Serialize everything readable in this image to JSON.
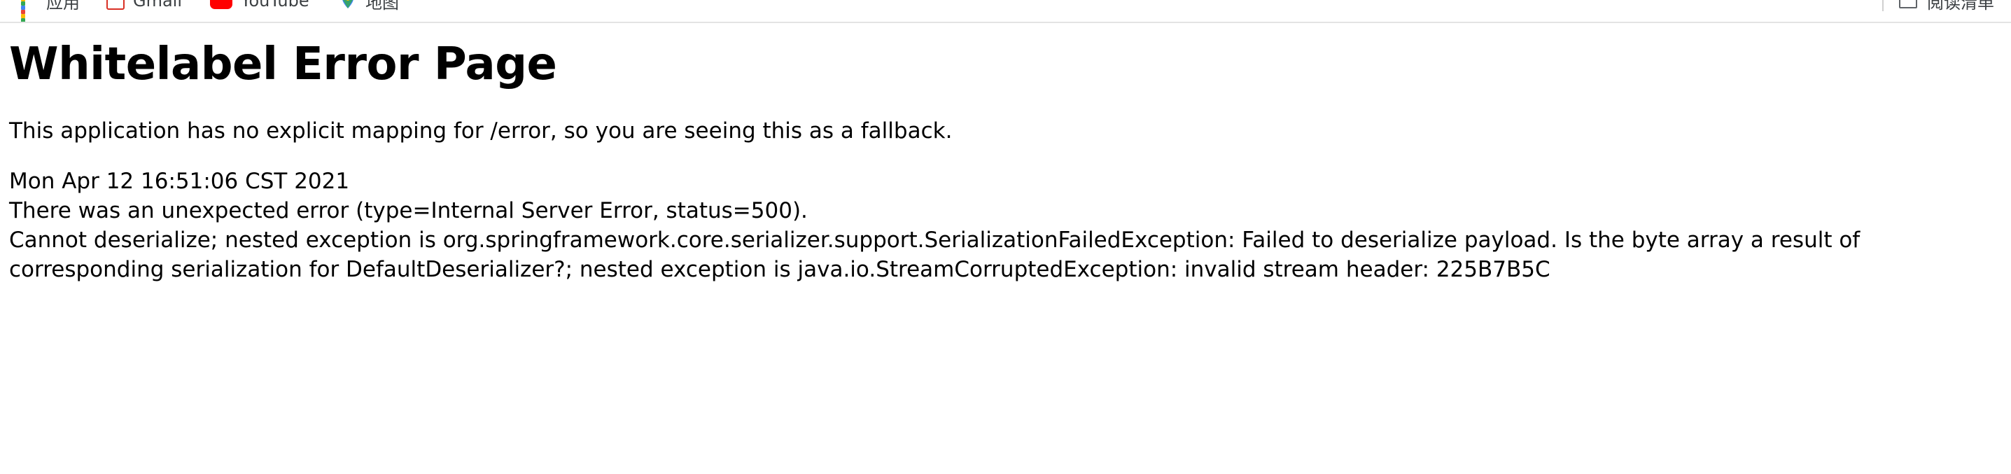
{
  "browser": {
    "bookmarks": [
      {
        "label": "应用",
        "icon": "apps-grid-icon"
      },
      {
        "label": "Gmail",
        "icon": "gmail-icon"
      },
      {
        "label": "YouTube",
        "icon": "youtube-icon"
      },
      {
        "label": "地图",
        "icon": "maps-icon"
      }
    ],
    "reading_list": {
      "label": "阅读清单",
      "icon": "reading-list-icon"
    }
  },
  "page": {
    "title": "Whitelabel Error Page",
    "fallback_message": "This application has no explicit mapping for /error, so you are seeing this as a fallback.",
    "timestamp": "Mon Apr 12 16:51:06 CST 2021",
    "error_summary": "There was an unexpected error (type=Internal Server Error, status=500).",
    "error_detail": "Cannot deserialize; nested exception is org.springframework.core.serializer.support.SerializationFailedException: Failed to deserialize payload. Is the byte array a result of corresponding serialization for DefaultDeserializer?; nested exception is java.io.StreamCorruptedException: invalid stream header: 225B7B5C"
  },
  "colors": {
    "apps_icon": [
      "#ea4335",
      "#fbbc04",
      "#34a853",
      "#4285f4"
    ],
    "youtube": "#ff0000",
    "gmail": "#d93025"
  }
}
